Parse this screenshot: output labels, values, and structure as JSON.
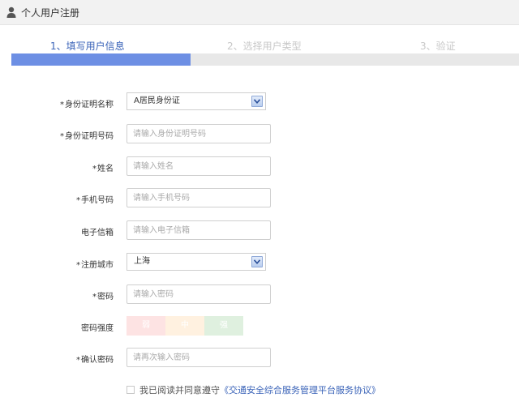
{
  "header": {
    "title": "个人用户注册",
    "icon": "user-icon"
  },
  "steps": [
    {
      "label": "1、填写用户信息",
      "active": true
    },
    {
      "label": "2、选择用户类型",
      "active": false
    },
    {
      "label": "3、验证",
      "active": false
    }
  ],
  "progress": {
    "completed_steps": 1,
    "total_steps": 3
  },
  "form": {
    "id_type": {
      "label": "身份证明名称",
      "required": true,
      "value": "A居民身份证"
    },
    "id_number": {
      "label": "身份证明号码",
      "required": true,
      "placeholder": "请输入身份证明号码"
    },
    "name": {
      "label": "姓名",
      "required": true,
      "placeholder": "请输入姓名"
    },
    "phone": {
      "label": "手机号码",
      "required": true,
      "placeholder": "请输入手机号码"
    },
    "email": {
      "label": "电子信箱",
      "required": false,
      "placeholder": "请输入电子信箱"
    },
    "city": {
      "label": "注册城市",
      "required": true,
      "value": "上海"
    },
    "password": {
      "label": "密码",
      "required": true,
      "placeholder": "请输入密码"
    },
    "strength": {
      "label": "密码强度",
      "weak": "弱",
      "medium": "中",
      "strong": "强"
    },
    "confirm": {
      "label": "确认密码",
      "required": true,
      "placeholder": "请再次输入密码"
    }
  },
  "agreement": {
    "prefix": "我已阅读并同意遵守",
    "link": "《交通安全综合服务管理平台服务协议》",
    "checked": false
  },
  "colors": {
    "accent": "#3a63b8",
    "progress": "#6d8fe4",
    "weak_bg": "#fde3e3",
    "medium_bg": "#fff1e0",
    "strong_bg": "#dff0df"
  }
}
